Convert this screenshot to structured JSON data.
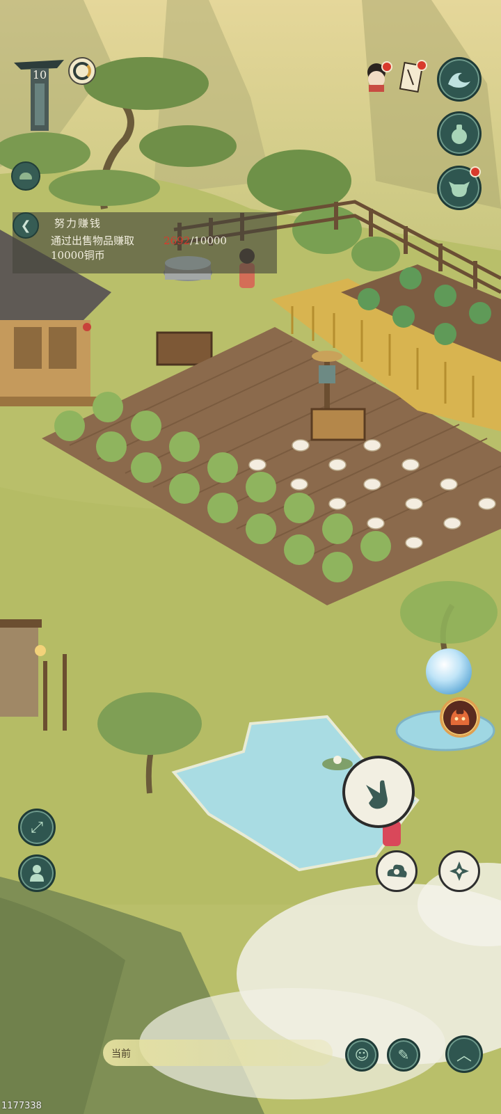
{
  "player": {
    "level": "10"
  },
  "quest": {
    "title": "努力赚钱",
    "line1_prefix": "通过出售物品赚取",
    "progress_current": "2692",
    "progress_sep_total": "/10000",
    "line2": "10000铜币"
  },
  "chat": {
    "channel_label": "当前"
  },
  "build_id": "1177338",
  "icons": {
    "top_right": [
      "npc-portrait-icon",
      "scroll-letter-icon",
      "wave-skill-icon",
      "gourd-bag-icon",
      "ox-head-icon"
    ],
    "left": [
      "map-toggle-icon",
      "back-arrow-icon",
      "expand-arrows-icon",
      "person-marker-icon"
    ],
    "action": [
      "tap-hand-icon",
      "cloud-swirl-icon",
      "shuriken-diamond-icon",
      "fire-beast-icon"
    ],
    "bottom": [
      "smile-emote-icon",
      "brush-write-icon",
      "chevron-up-icon"
    ]
  },
  "colors": {
    "accent_red": "#d83a2c",
    "button_teal": "#2f5650",
    "grass": "#b9bf6a",
    "water": "#a9dce3"
  }
}
